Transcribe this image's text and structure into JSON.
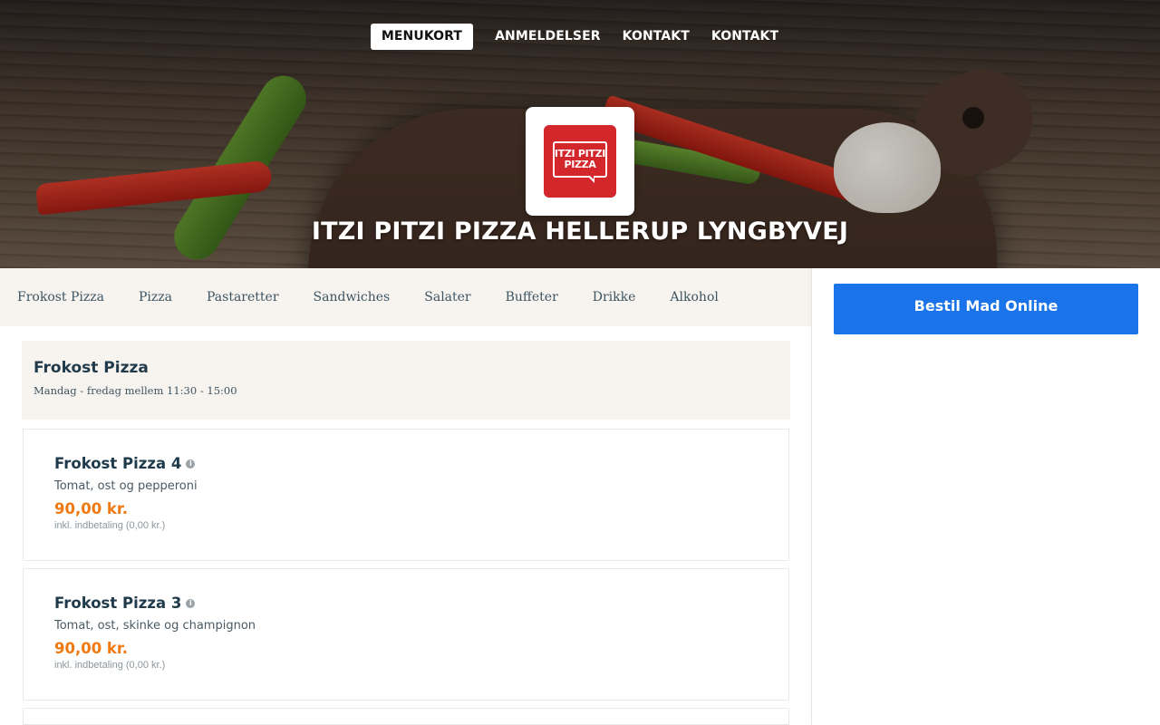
{
  "top_nav": {
    "items": [
      {
        "label": "MENUKORT",
        "active": true
      },
      {
        "label": "ANMELDELSER",
        "active": false
      },
      {
        "label": "KONTAKT",
        "active": false
      },
      {
        "label": "KONTAKT",
        "active": false
      }
    ]
  },
  "logo": {
    "text": "ITZI PITZI PIZZA"
  },
  "hero": {
    "title": "ITZI PITZI PIZZA HELLERUP LYNGBYVEJ"
  },
  "categories": [
    "Frokost Pizza",
    "Pizza",
    "Pastaretter",
    "Sandwiches",
    "Salater",
    "Buffeter",
    "Drikke",
    "Alkohol"
  ],
  "order_button": {
    "label": "Bestil Mad Online"
  },
  "section": {
    "title": "Frokost Pizza",
    "subtitle": "Mandag - fredag mellem 11:30 - 15:00"
  },
  "items": [
    {
      "name": "Frokost Pizza 4",
      "info_icon": "i",
      "description": "Tomat, ost og pepperoni",
      "price": "90,00 kr.",
      "note": "inkl. indbetaling (0,00 kr.)"
    },
    {
      "name": "Frokost Pizza 3",
      "info_icon": "i",
      "description": "Tomat, ost, skinke og champignon",
      "price": "90,00 kr.",
      "note": "inkl. indbetaling (0,00 kr.)"
    }
  ],
  "colors": {
    "accent_blue": "#1a73e8",
    "price_orange": "#f07a11",
    "logo_red": "#d3272b",
    "category_bar_bg": "#f7f3ef"
  }
}
